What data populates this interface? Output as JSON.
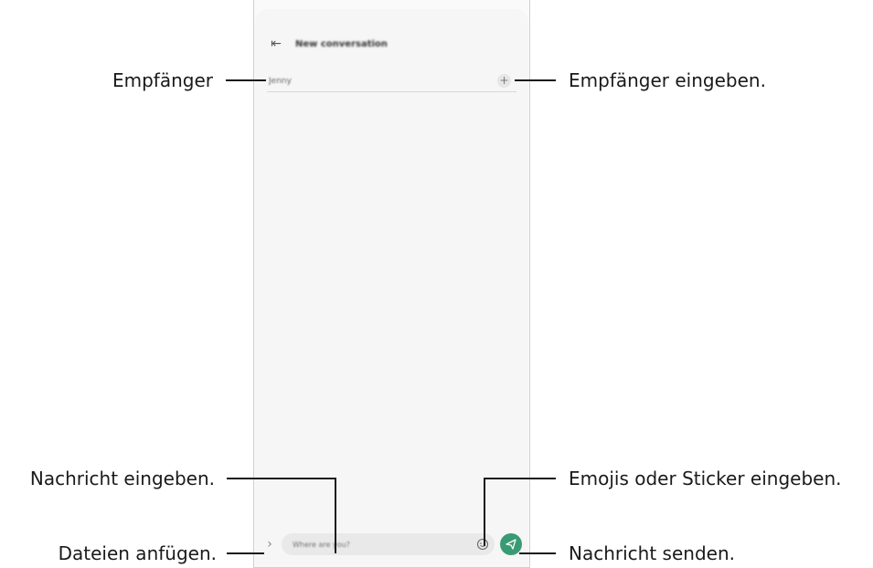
{
  "phone": {
    "header": {
      "back_icon": "back-arrow-icon",
      "title": "New conversation"
    },
    "recipient": {
      "value": "Jenny",
      "add_icon": "plus"
    },
    "composer": {
      "attach_icon": "chevron-right-icon",
      "message_placeholder": "Where are you?",
      "emoji_icon": "smiley-icon",
      "send_icon": "send-icon",
      "send_color": "#3a9a74"
    }
  },
  "callouts": {
    "recipient": "Empfänger",
    "enter_recipient": "Empfänger eingeben.",
    "enter_message": "Nachricht eingeben.",
    "attach_files": "Dateien anfügen.",
    "enter_emoji": "Emojis oder Sticker eingeben.",
    "send_message": "Nachricht senden."
  }
}
